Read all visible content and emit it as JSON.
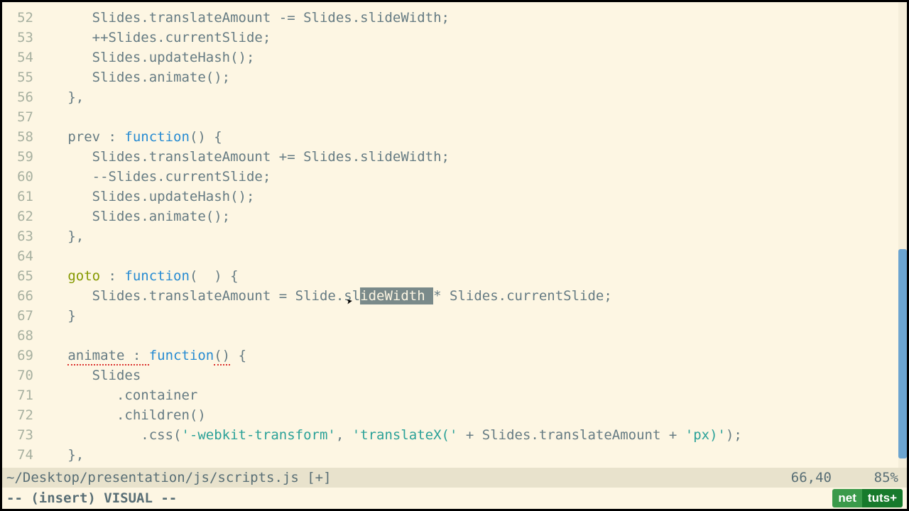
{
  "editor": {
    "first_line": 52,
    "lines": [
      {
        "n": 52,
        "indent": "      ",
        "tokens": [
          {
            "t": "Slides.translateAmount ",
            "c": "id"
          },
          {
            "t": "-= ",
            "c": "op"
          },
          {
            "t": "Slides.slideWidth;",
            "c": "id"
          }
        ]
      },
      {
        "n": 53,
        "indent": "      ",
        "tokens": [
          {
            "t": "++",
            "c": "op"
          },
          {
            "t": "Slides.currentSlide;",
            "c": "id"
          }
        ]
      },
      {
        "n": 54,
        "indent": "      ",
        "tokens": [
          {
            "t": "Slides.updateHash();",
            "c": "id"
          }
        ]
      },
      {
        "n": 55,
        "indent": "      ",
        "tokens": [
          {
            "t": "Slides.animate();",
            "c": "id"
          }
        ]
      },
      {
        "n": 56,
        "indent": "   ",
        "tokens": [
          {
            "t": "},",
            "c": "punct"
          }
        ]
      },
      {
        "n": 57,
        "indent": "",
        "tokens": []
      },
      {
        "n": 58,
        "indent": "   ",
        "tokens": [
          {
            "t": "prev ",
            "c": "id"
          },
          {
            "t": ": ",
            "c": "op"
          },
          {
            "t": "function",
            "c": "key"
          },
          {
            "t": "() {",
            "c": "punct"
          }
        ]
      },
      {
        "n": 59,
        "indent": "      ",
        "tokens": [
          {
            "t": "Slides.translateAmount ",
            "c": "id"
          },
          {
            "t": "+= ",
            "c": "op"
          },
          {
            "t": "Slides.slideWidth;",
            "c": "id"
          }
        ]
      },
      {
        "n": 60,
        "indent": "      ",
        "tokens": [
          {
            "t": "--",
            "c": "op"
          },
          {
            "t": "Slides.currentSlide;",
            "c": "id"
          }
        ]
      },
      {
        "n": 61,
        "indent": "      ",
        "tokens": [
          {
            "t": "Slides.updateHash();",
            "c": "id"
          }
        ]
      },
      {
        "n": 62,
        "indent": "      ",
        "tokens": [
          {
            "t": "Slides.animate();",
            "c": "id"
          }
        ]
      },
      {
        "n": 63,
        "indent": "   ",
        "tokens": [
          {
            "t": "},",
            "c": "punct"
          }
        ]
      },
      {
        "n": 64,
        "indent": "",
        "tokens": []
      },
      {
        "n": 65,
        "indent": "   ",
        "tokens": [
          {
            "t": "goto ",
            "c": "func"
          },
          {
            "t": ": ",
            "c": "op"
          },
          {
            "t": "function",
            "c": "key"
          },
          {
            "t": "(  ) {",
            "c": "punct"
          }
        ]
      },
      {
        "n": 66,
        "indent": "      ",
        "tokens": [
          {
            "t": "Slides.translateAmount ",
            "c": "id"
          },
          {
            "t": "= ",
            "c": "op"
          },
          {
            "t": "Slide.sl",
            "c": "id"
          },
          {
            "t": "ideWidth ",
            "c": "sel"
          },
          {
            "t": "* ",
            "c": "op"
          },
          {
            "t": "Slides.currentSlide;",
            "c": "id"
          }
        ]
      },
      {
        "n": 67,
        "indent": "   ",
        "tokens": [
          {
            "t": "}",
            "c": "punct"
          }
        ]
      },
      {
        "n": 68,
        "indent": "",
        "tokens": []
      },
      {
        "n": 69,
        "indent": "   ",
        "tokens": [
          {
            "t": "animate : ",
            "c": "err"
          },
          {
            "t": "function",
            "c": "key"
          },
          {
            "t": "()",
            "c": "err"
          },
          {
            "t": " {",
            "c": "punct"
          }
        ]
      },
      {
        "n": 70,
        "indent": "      ",
        "tokens": [
          {
            "t": "Slides",
            "c": "id"
          }
        ]
      },
      {
        "n": 71,
        "indent": "         ",
        "tokens": [
          {
            "t": ".container",
            "c": "id"
          }
        ]
      },
      {
        "n": 72,
        "indent": "         ",
        "tokens": [
          {
            "t": ".children()",
            "c": "id"
          }
        ]
      },
      {
        "n": 73,
        "indent": "            ",
        "tokens": [
          {
            "t": ".css(",
            "c": "id"
          },
          {
            "t": "'-webkit-transform'",
            "c": "str"
          },
          {
            "t": ", ",
            "c": "punct"
          },
          {
            "t": "'translateX('",
            "c": "str"
          },
          {
            "t": " + ",
            "c": "op"
          },
          {
            "t": "Slides.translateAmount ",
            "c": "id"
          },
          {
            "t": "+ ",
            "c": "op"
          },
          {
            "t": "'px)'",
            "c": "str"
          },
          {
            "t": ");",
            "c": "punct"
          }
        ]
      },
      {
        "n": 74,
        "indent": "   ",
        "tokens": [
          {
            "t": "},",
            "c": "punct"
          }
        ]
      }
    ]
  },
  "status": {
    "filename": "~/Desktop/presentation/js/scripts.js [+]",
    "position": "66,40",
    "percent": "85%"
  },
  "mode": {
    "text": "-- (insert) VISUAL --",
    "right": "9"
  },
  "logo": {
    "left": "net",
    "right": "tuts+"
  },
  "scrollbar": {
    "top_pct": 53,
    "height_pct": 45
  }
}
